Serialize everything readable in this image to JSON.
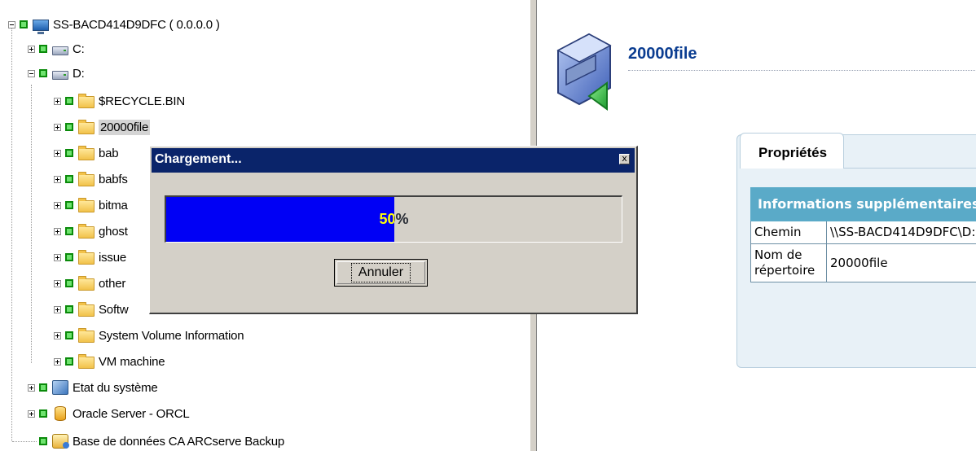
{
  "tree": {
    "root": {
      "label": "SS-BACD414D9DFC ( 0.0.0.0 )",
      "icon": "computer-icon"
    },
    "drives": [
      {
        "label": "C:",
        "icon": "drive-icon"
      },
      {
        "label": "D:",
        "icon": "drive-icon"
      }
    ],
    "folders": [
      {
        "label": "$RECYCLE.BIN"
      },
      {
        "label": "20000file"
      },
      {
        "label": "bab"
      },
      {
        "label": "babfs"
      },
      {
        "label": "bitma"
      },
      {
        "label": "ghost"
      },
      {
        "label": "issue"
      },
      {
        "label": "other"
      },
      {
        "label": "Softw"
      },
      {
        "label": "System Volume Information"
      },
      {
        "label": "VM machine"
      }
    ],
    "system_state": {
      "label": "Etat du système",
      "icon": "system-state-icon"
    },
    "oracle": {
      "label": "Oracle Server - ORCL",
      "icon": "database-icon"
    },
    "arcserve_db": {
      "label": "Base de données CA ARCserve Backup",
      "icon": "arcserve-db-icon"
    }
  },
  "details": {
    "title": "20000file",
    "tab_label": "Propriétés",
    "table_header": "Informations supplémentaires",
    "rows": [
      {
        "key": "Chemin",
        "value": "\\\\SS-BACD414D9DFC\\D:"
      },
      {
        "key": "Nom de répertoire",
        "value": "20000file"
      }
    ]
  },
  "dialog": {
    "title": "Chargement...",
    "close_label": "x",
    "progress_percent": 50,
    "progress_text": "50%",
    "cancel_label": "Annuler"
  },
  "colors": {
    "titlebar": "#0a246a",
    "progress": "#0000f5",
    "table_header": "#5aaac8",
    "detail_title": "#0b3d91"
  }
}
